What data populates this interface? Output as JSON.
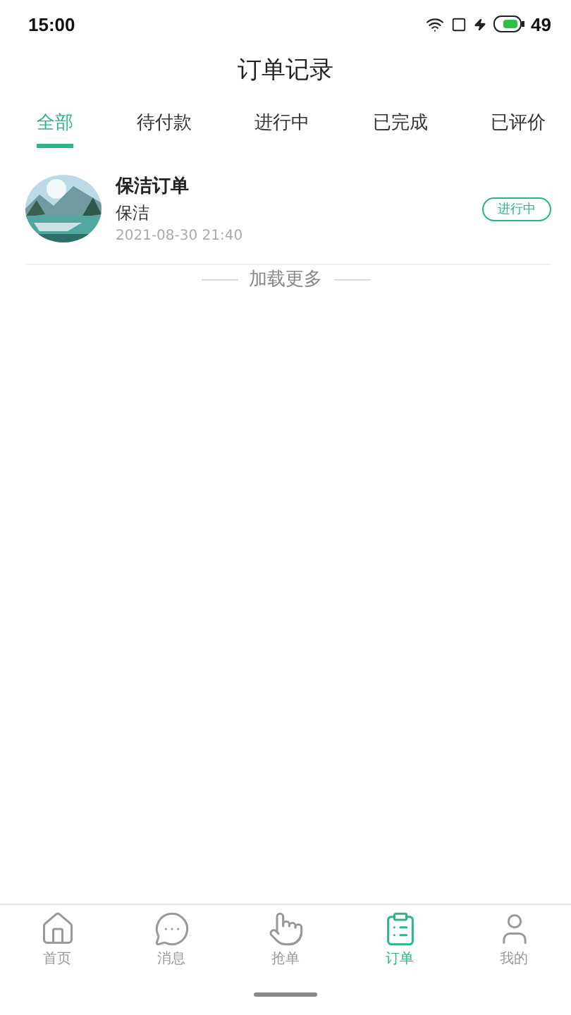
{
  "status_bar": {
    "time": "15:00",
    "battery": "49"
  },
  "header": {
    "title": "订单记录"
  },
  "tabs": [
    {
      "label": "全部",
      "selected": true
    },
    {
      "label": "待付款",
      "selected": false
    },
    {
      "label": "进行中",
      "selected": false
    },
    {
      "label": "已完成",
      "selected": false
    },
    {
      "label": "已评价",
      "selected": false
    }
  ],
  "orders": [
    {
      "title": "保洁订单",
      "service": "保洁",
      "time": "2021-08-30 21:40",
      "status": "进行中"
    }
  ],
  "load_more": "加载更多",
  "bottom_nav": [
    {
      "label": "首页",
      "selected": false
    },
    {
      "label": "消息",
      "selected": false
    },
    {
      "label": "抢单",
      "selected": false
    },
    {
      "label": "订单",
      "selected": true
    },
    {
      "label": "我的",
      "selected": false
    }
  ]
}
